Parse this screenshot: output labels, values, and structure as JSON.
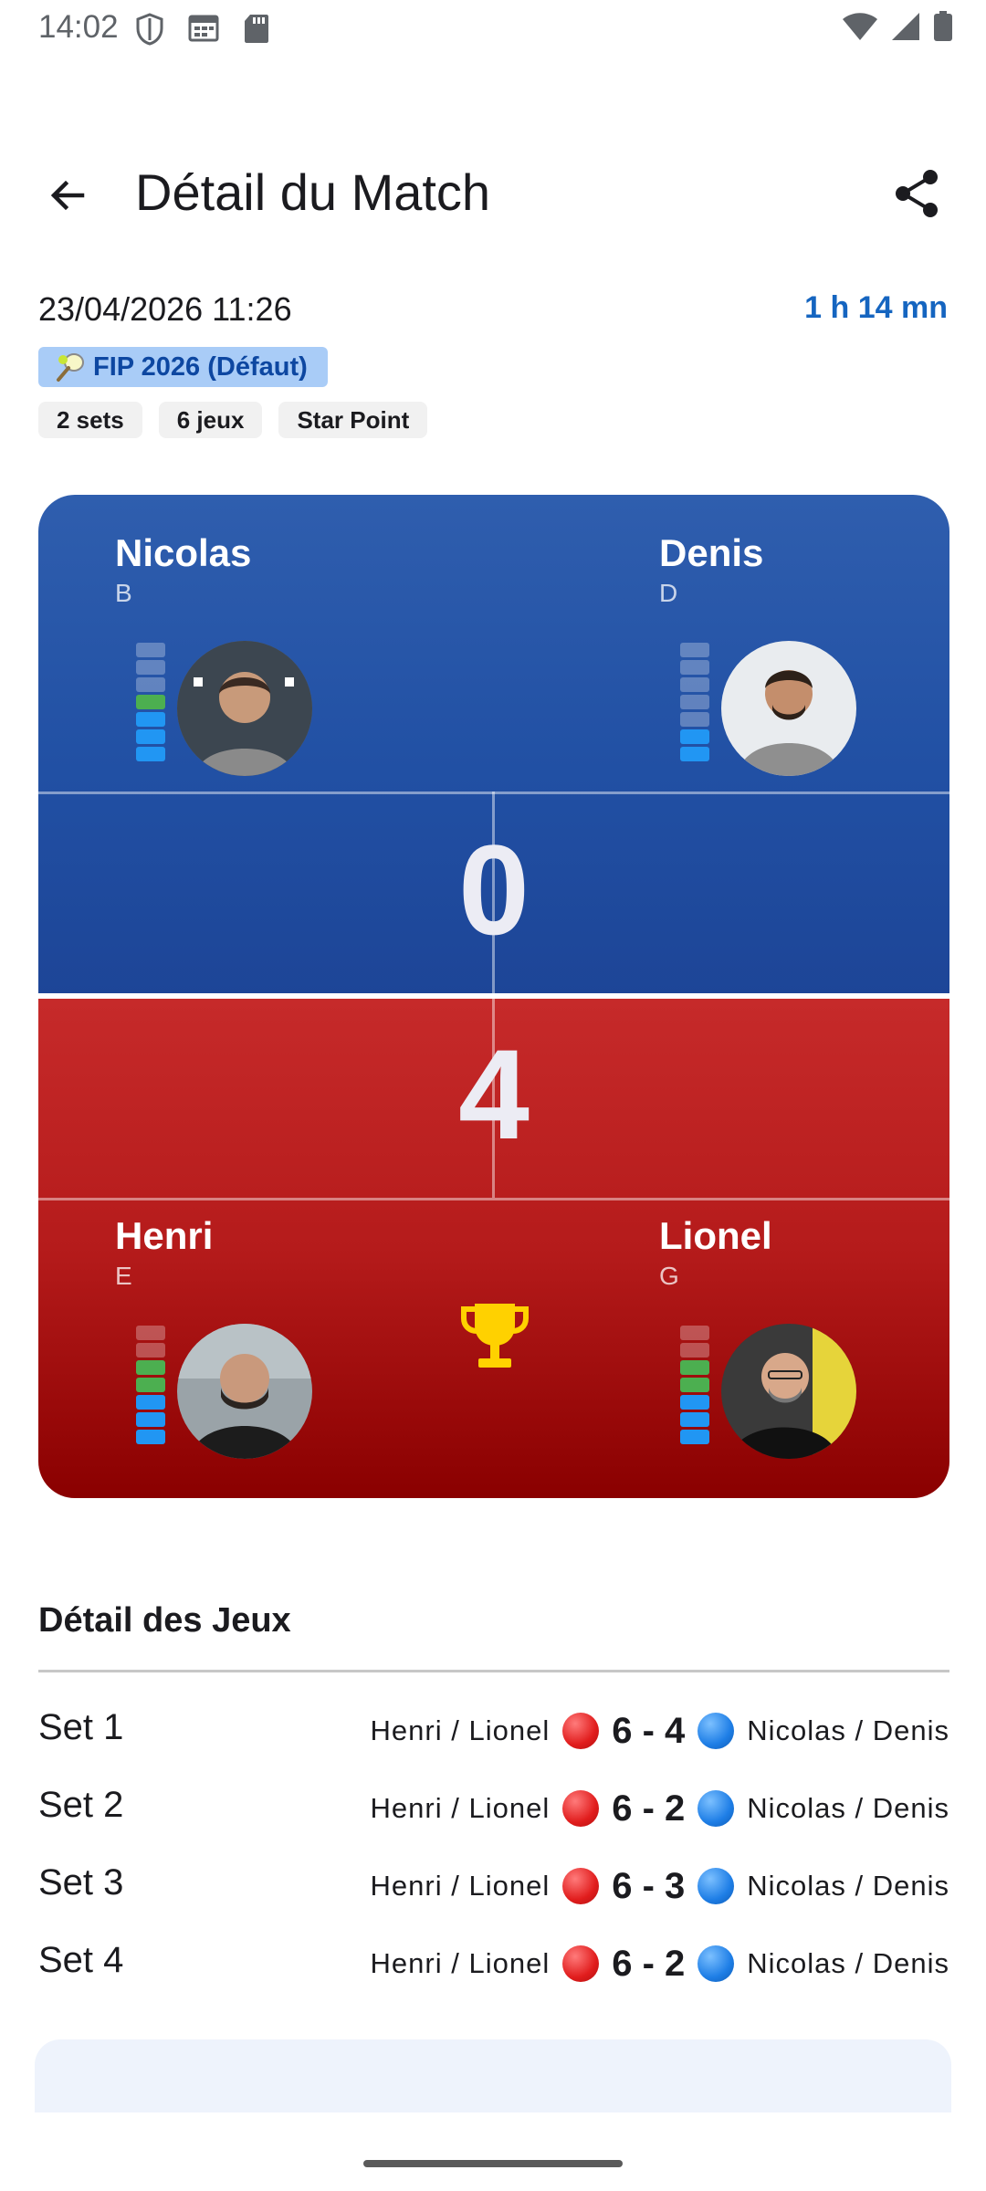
{
  "status_bar": {
    "time": "14:02"
  },
  "app_bar": {
    "title": "Détail du Match"
  },
  "match": {
    "date": "23/04/2026 11:26",
    "duration": "1 h 14 mn",
    "tournament": "FIP 2026 (Défaut)",
    "tags": [
      "2 sets",
      "6 jeux",
      "Star Point"
    ]
  },
  "scoreboard": {
    "blue_team": {
      "score": "0",
      "players": [
        {
          "name": "Nicolas",
          "position": "B",
          "level_green": 1,
          "level_blue": 3
        },
        {
          "name": "Denis",
          "position": "D",
          "level_green": 0,
          "level_blue": 2
        }
      ]
    },
    "red_team": {
      "score": "4",
      "players": [
        {
          "name": "Henri",
          "position": "E",
          "level_green": 2,
          "level_blue": 3
        },
        {
          "name": "Lionel",
          "position": "G",
          "level_green": 2,
          "level_blue": 3
        }
      ]
    },
    "winner_icon": "trophy-icon",
    "colors": {
      "blue": "#2150a4",
      "red": "#b51b1b",
      "trophy": "#ffd100",
      "level_green": "#4caf50",
      "level_blue": "#2196f3"
    }
  },
  "games": {
    "title": "Détail des Jeux",
    "sets": [
      {
        "label": "Set 1",
        "team_a": "Henri / Lionel",
        "score": "6 - 4",
        "team_b": "Nicolas / Denis"
      },
      {
        "label": "Set 2",
        "team_a": "Henri / Lionel",
        "score": "6 - 2",
        "team_b": "Nicolas / Denis"
      },
      {
        "label": "Set 3",
        "team_a": "Henri / Lionel",
        "score": "6 - 3",
        "team_b": "Nicolas / Denis"
      },
      {
        "label": "Set 4",
        "team_a": "Henri / Lionel",
        "score": "6 - 2",
        "team_b": "Nicolas / Denis"
      }
    ]
  }
}
